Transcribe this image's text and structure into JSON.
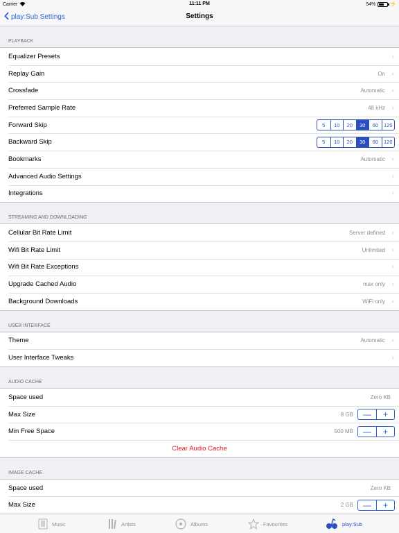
{
  "status": {
    "carrier": "Carrier",
    "time": "11:11 PM",
    "battery": "54%"
  },
  "nav": {
    "back_label": "play:Sub Settings",
    "title": "Settings"
  },
  "playback": {
    "header": "PLAYBACK",
    "equalizer": "Equalizer Presets",
    "replay_gain": {
      "label": "Replay Gain",
      "value": "On"
    },
    "crossfade": {
      "label": "Crossfade",
      "value": "Automatic"
    },
    "sample_rate": {
      "label": "Preferred Sample Rate",
      "value": "48 kHz"
    },
    "forward_skip": {
      "label": "Forward Skip",
      "options": [
        "5",
        "10",
        "20",
        "30",
        "60",
        "120"
      ],
      "selected": "30"
    },
    "backward_skip": {
      "label": "Backward Skip",
      "options": [
        "5",
        "10",
        "20",
        "30",
        "60",
        "120"
      ],
      "selected": "30"
    },
    "bookmarks": {
      "label": "Bookmarks",
      "value": "Automatic"
    },
    "advanced": "Advanced Audio Settings",
    "integrations": "Integrations"
  },
  "streaming": {
    "header": "STREAMING AND DOWNLOADING",
    "cellular": {
      "label": "Cellular Bit Rate Limit",
      "value": "Server defined"
    },
    "wifi": {
      "label": "Wifi Bit Rate Limit",
      "value": "Unlimited"
    },
    "wifi_exceptions": "Wifi Bit Rate Exceptions",
    "upgrade": {
      "label": "Upgrade Cached Audio",
      "value": "max only"
    },
    "background": {
      "label": "Background Downloads",
      "value": "WiFi only"
    }
  },
  "ui": {
    "header": "USER INTERFACE",
    "theme": {
      "label": "Theme",
      "value": "Automatic"
    },
    "tweaks": "User Interface Tweaks"
  },
  "audio_cache": {
    "header": "AUDIO CACHE",
    "space_used": {
      "label": "Space used",
      "value": "Zero KB"
    },
    "max_size": {
      "label": "Max Size",
      "value": "8 GB"
    },
    "min_free": {
      "label": "Min Free Space",
      "value": "500 MB"
    },
    "clear": "Clear Audio Cache"
  },
  "image_cache": {
    "header": "IMAGE CACHE",
    "space_used": {
      "label": "Space used",
      "value": "Zero KB"
    },
    "max_size": {
      "label": "Max Size",
      "value": "2 GB"
    }
  },
  "stepper": {
    "minus": "—",
    "plus": "+"
  },
  "tabs": {
    "music": "Music",
    "artists": "Artists",
    "albums": "Albums",
    "favourites": "Favourites",
    "playsub": "play:Sub"
  },
  "colors": {
    "accent": "#2b4fbf",
    "destructive": "#e0141e",
    "background": "#efeff4"
  }
}
